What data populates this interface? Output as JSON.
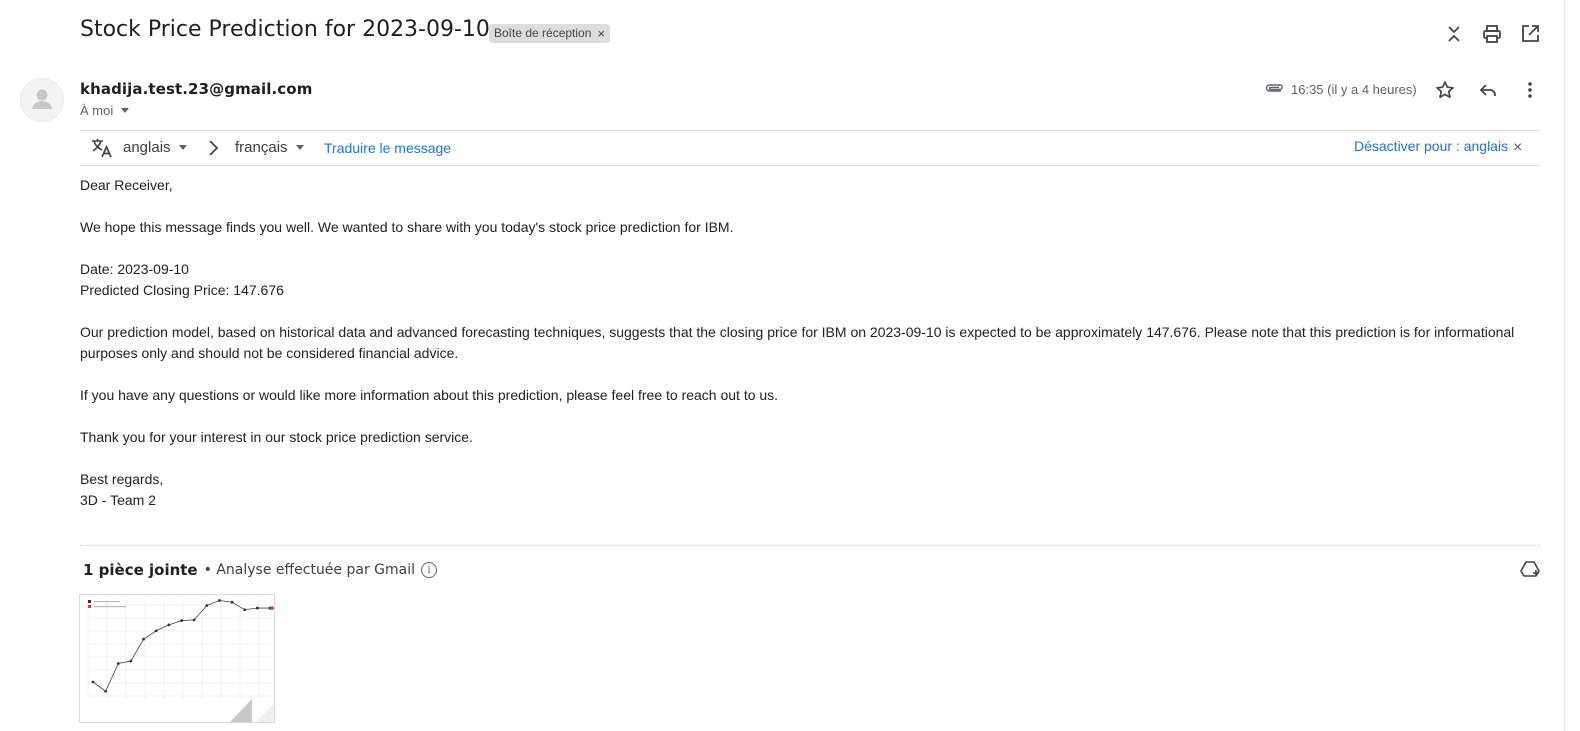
{
  "email": {
    "subject": "Stock Price Prediction for 2023-09-10",
    "label": "Boîte de réception",
    "sender": "khadija.test.23@gmail.com",
    "recipient": "À moi",
    "time": "16:35 (il y a 4 heures)"
  },
  "translate": {
    "source_lang": "anglais",
    "target_lang": "français",
    "translate_link": "Traduire le message",
    "disable_link": "Désactiver pour : anglais"
  },
  "body": {
    "greeting": "Dear Receiver,",
    "p1": "We hope this message finds you well. We wanted to share with you today's stock price prediction for IBM.",
    "date_line": "Date: 2023-09-10",
    "price_line": "Predicted Closing Price: 147.676",
    "p2": "Our prediction model, based on historical data and advanced forecasting techniques, suggests that the closing price for IBM on 2023-09-10 is expected to be approximately 147.676. Please note that this prediction is for informational purposes only and should not be considered financial advice.",
    "p3": "If you have any questions or would like more information about this prediction, please feel free to reach out to us.",
    "p4": "Thank you for your interest in our stock price prediction service.",
    "closing": "Best regards,",
    "signature": "3D - Team 2"
  },
  "attachments": {
    "count_label": "1 pièce jointe",
    "scan_label": "• Analyse effectuée par Gmail"
  },
  "icons": {
    "close": "expand-collapse-icon",
    "print": "print-icon",
    "open": "open-in-new-window-icon",
    "attachment": "paperclip-icon",
    "star": "star-icon",
    "reply": "reply-icon",
    "more": "more-vert-icon",
    "translate": "translate-icon",
    "drive": "add-to-drive-icon"
  },
  "thumbnail_chart": {
    "series": [
      {
        "values": [
          0.25,
          0.14,
          0.47,
          0.5,
          0.76,
          0.86,
          0.93,
          0.98,
          0.99,
          1.16,
          1.22,
          1.2,
          1.11,
          1.13,
          1.13
        ]
      },
      {
        "values": [
          1.13
        ]
      }
    ],
    "colors": {
      "actual": "#333333",
      "predicted": "#e53935"
    }
  }
}
